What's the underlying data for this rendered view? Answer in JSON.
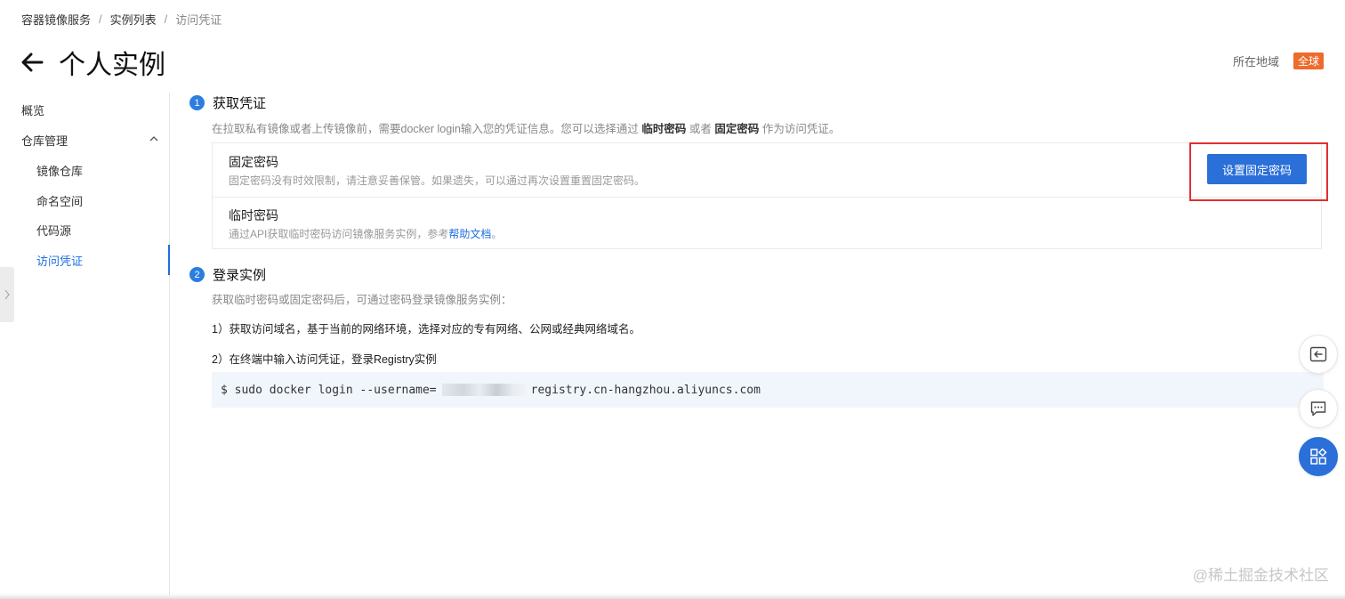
{
  "breadcrumb": {
    "items": [
      "容器镜像服务",
      "实例列表"
    ],
    "separator": "/",
    "current": "访问凭证"
  },
  "header": {
    "title": "个人实例"
  },
  "region": {
    "label": "所在地域",
    "tag": "全球",
    "tag_color": "#ee6b2d"
  },
  "sidebar": {
    "overview": "概览",
    "repo_mgmt": "仓库管理",
    "items": [
      "镜像仓库",
      "命名空间",
      "代码源",
      "访问凭证"
    ],
    "active": "访问凭证"
  },
  "section1": {
    "num": "1",
    "title": "获取凭证",
    "desc_prefix": "在拉取私有镜像或者上传镜像前，需要docker login输入您的凭证信息。您可以选择通过",
    "desc_opt1": "临时密码",
    "desc_mid": "或者",
    "desc_opt2": "固定密码",
    "desc_suffix": "作为访问凭证。",
    "fixed": {
      "title": "固定密码",
      "desc": "固定密码没有时效限制，请注意妥善保管。如果遗失，可以通过再次设置重置固定密码。",
      "button": "设置固定密码"
    },
    "temp": {
      "title": "临时密码",
      "desc_prefix": "通过API获取临时密码访问镜像服务实例，参考",
      "link": "帮助文档",
      "desc_suffix": "。"
    }
  },
  "section2": {
    "num": "2",
    "title": "登录实例",
    "desc": "获取临时密码或固定密码后，可通过密码登录镜像服务实例：",
    "step1": "1）获取访问域名，基于当前的网络环境，选择对应的专有网络、公网或经典网络域名。",
    "step2": "2）在终端中输入访问凭证，登录Registry实例",
    "command_prefix": "$ sudo docker login --username=",
    "command_suffix": "registry.cn-hangzhou.aliyuncs.com"
  },
  "watermark": "@稀土掘金技术社区",
  "colors": {
    "primary": "#2b6fd8",
    "link": "#1f6fe0",
    "highlight": "#e03030"
  }
}
